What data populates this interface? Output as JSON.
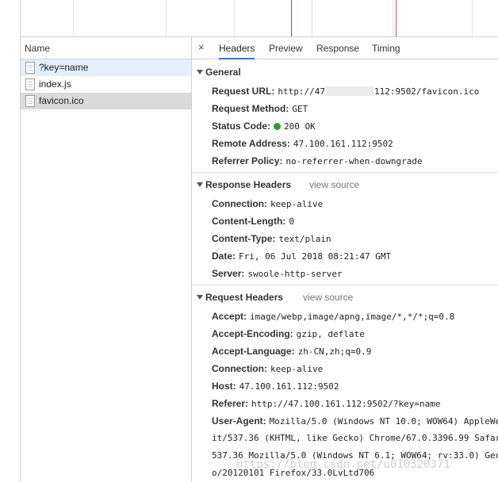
{
  "name_column": {
    "header": "Name",
    "requests": [
      {
        "name": "?key=name",
        "state": "highlighted"
      },
      {
        "name": "index.js",
        "state": "normal"
      },
      {
        "name": "favicon.ico",
        "state": "selected"
      }
    ]
  },
  "tabs": {
    "close": "×",
    "items": [
      "Headers",
      "Preview",
      "Response",
      "Timing"
    ],
    "active": "Headers"
  },
  "general": {
    "title": "General",
    "request_url_label": "Request URL:",
    "request_url_prefix": "http://47",
    "request_url_suffix": "112:9502/favicon.ico",
    "request_method_label": "Request Method:",
    "request_method": "GET",
    "status_code_label": "Status Code:",
    "status_code": "200 OK",
    "remote_address_label": "Remote Address:",
    "remote_address": "47.100.161.112:9502",
    "referrer_policy_label": "Referrer Policy:",
    "referrer_policy": "no-referrer-when-downgrade"
  },
  "response_headers": {
    "title": "Response Headers",
    "view_source": "view source",
    "connection_label": "Connection:",
    "connection": "keep-alive",
    "content_length_label": "Content-Length:",
    "content_length": "0",
    "content_type_label": "Content-Type:",
    "content_type": "text/plain",
    "date_label": "Date:",
    "date": "Fri, 06 Jul 2018 08:21:47 GMT",
    "server_label": "Server:",
    "server": "swoole-http-server"
  },
  "request_headers": {
    "title": "Request Headers",
    "view_source": "view source",
    "accept_label": "Accept:",
    "accept": "image/webp,image/apng,image/*,*/*;q=0.8",
    "accept_encoding_label": "Accept-Encoding:",
    "accept_encoding": "gzip, deflate",
    "accept_language_label": "Accept-Language:",
    "accept_language": "zh-CN,zh;q=0.9",
    "connection_label": "Connection:",
    "connection": "keep-alive",
    "host_label": "Host:",
    "host": "47.100.161.112:9502",
    "referer_label": "Referer:",
    "referer": "http://47.100.161.112:9502/?key=name",
    "user_agent_label": "User-Agent:",
    "user_agent_line1": "Mozilla/5.0 (Windows NT 10.0; WOW64) AppleWe",
    "user_agent_line2": "it/537.36 (KHTML, like Gecko) Chrome/67.0.3396.99 Safar",
    "user_agent_line3": "537.36 Mozilla/5.0 (Windows NT 6.1; WOW64; rv:33.0) Gec",
    "user_agent_line4": "o/20120101 Firefox/33.0LvLtd706"
  },
  "watermark": "https://blog.csdn.net/u010320371",
  "colors": {
    "accent": "#3879d9",
    "status_ok": "#2e9e2e",
    "timeline_blue": "#5b5bd6",
    "timeline_red": "#e04b4b"
  }
}
